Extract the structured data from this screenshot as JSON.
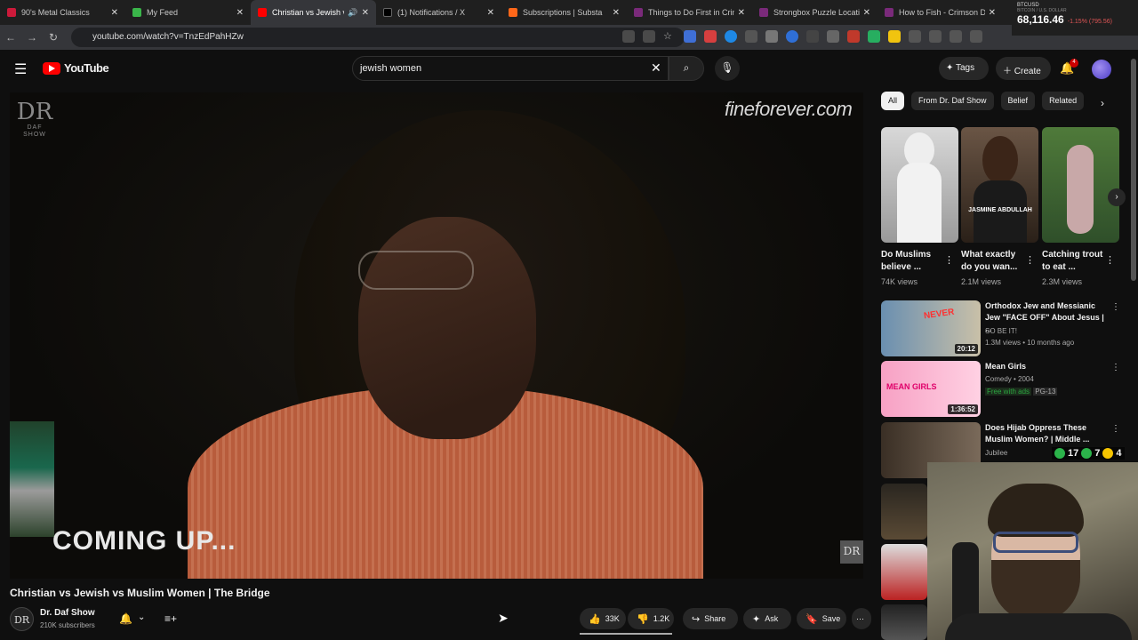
{
  "browser": {
    "tabs": [
      {
        "title": "90's Metal Classics",
        "favicon_color": "#cc1a3a",
        "active": false
      },
      {
        "title": "My Feed",
        "favicon_color": "#3ab54a",
        "active": false
      },
      {
        "title": "Christian vs Jewish vs ",
        "favicon_color": "#ff0000",
        "active": true
      },
      {
        "title": "(1) Notifications / X",
        "favicon_color": "#000000",
        "active": false
      },
      {
        "title": "Subscriptions | Substa",
        "favicon_color": "#ff6719",
        "active": false
      },
      {
        "title": "Things to Do First in Crim",
        "favicon_color": "#7a2a7a",
        "active": false
      },
      {
        "title": "Strongbox Puzzle Location",
        "favicon_color": "#7a2a7a",
        "active": false
      },
      {
        "title": "How to Fish - Crimson De",
        "favicon_color": "#7a2a7a",
        "active": false
      }
    ],
    "url": "youtube.com/watch?v=TnzEdPahHZw"
  },
  "ticker": {
    "symbol": "BTCUSD",
    "subtitle": "BITCOIN / U.S. DOLLAR",
    "price": "68,116.46",
    "change": "-1.15% (795.56)"
  },
  "youtube": {
    "logo_text": "YouTube",
    "search_value": "jewish women",
    "tags_label": "Tags",
    "create_label": "Create",
    "notification_count": "4"
  },
  "video": {
    "channel_logo": "DR",
    "channel_logo_sub": "DAF SHOW",
    "watermark": "fineforever.com",
    "caption": "COMING UP...",
    "corner_logo": "DR",
    "title": "Christian vs Jewish vs Muslim Women | The Bridge",
    "channel_name": "Dr. Daf Show",
    "subscribers": "210K subscribers",
    "likes": "33K",
    "dislikes": "1.2K",
    "share_label": "Share",
    "ask_label": "Ask",
    "save_label": "Save"
  },
  "chips": [
    "All",
    "From Dr. Daf Show",
    "Belief",
    "Related"
  ],
  "shorts": [
    {
      "title": "Do Muslims believe ...",
      "views": "74K views"
    },
    {
      "title": "What exactly do you wan...",
      "views": "2.1M views"
    },
    {
      "title": "Catching trout to eat ...",
      "views": "2.3M views"
    }
  ],
  "short_overlay_text": "JASMINE ABDULLAH",
  "recommended": [
    {
      "title": "Orthodox Jew and Messianic Jew \"FACE OFF\" About Jesus | ...",
      "channel": "SO BE IT!",
      "meta": "1.3M views • 10 months ago",
      "duration": "20:12"
    },
    {
      "title": "Mean Girls",
      "channel": "Comedy • 2004",
      "meta": "Free with ads",
      "rating": "PG-13",
      "duration": "1:36:52"
    },
    {
      "title": "Does Hijab Oppress These Muslim Women? | Middle ...",
      "channel": "Jubilee",
      "meta": "",
      "duration": ""
    }
  ],
  "overlay_counts": [
    "17",
    "7",
    "4"
  ],
  "colors": {
    "bg": "#0f0f0f",
    "youtube_red": "#ff0000",
    "chip_bg": "#272727",
    "free_with_ads": "#2ba640"
  }
}
